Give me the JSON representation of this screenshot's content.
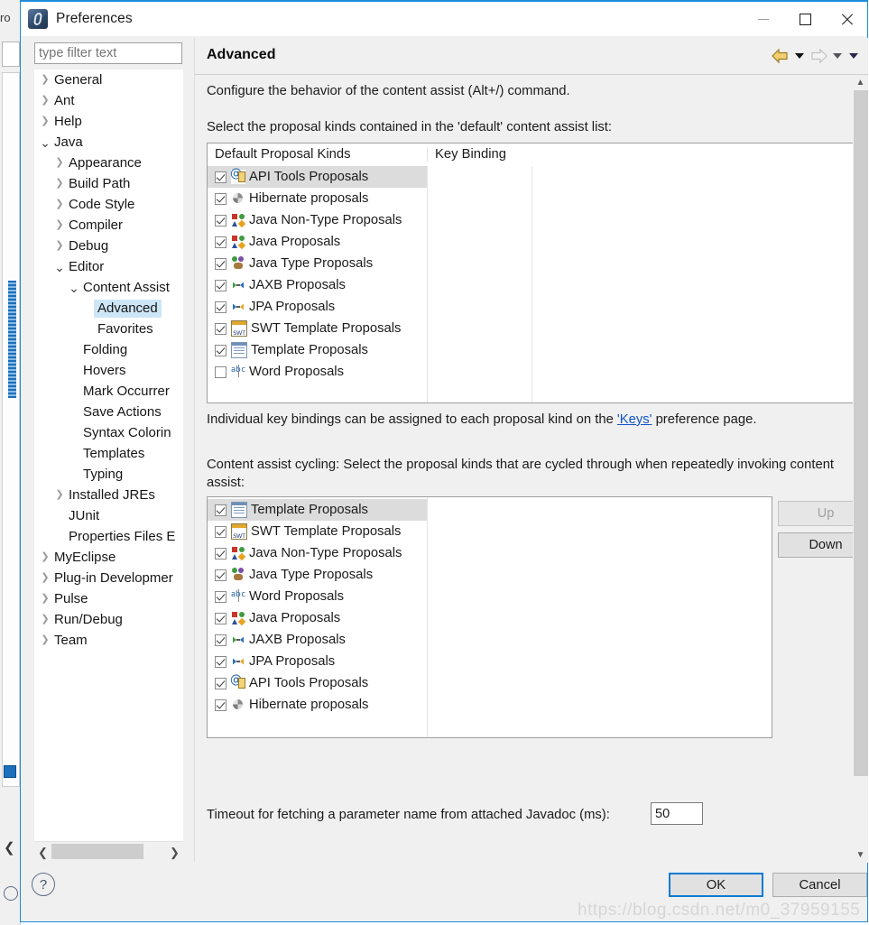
{
  "window": {
    "title": "Preferences",
    "app_icon": "eclipse-icon",
    "controls": {
      "minimize": "minimize-icon",
      "maximize": "maximize-icon",
      "close": "close-icon"
    }
  },
  "filter": {
    "placeholder": "type filter text",
    "value": ""
  },
  "tree": {
    "items": [
      {
        "label": "General",
        "indent": 0,
        "state": "collapsed"
      },
      {
        "label": "Ant",
        "indent": 0,
        "state": "collapsed"
      },
      {
        "label": "Help",
        "indent": 0,
        "state": "collapsed"
      },
      {
        "label": "Java",
        "indent": 0,
        "state": "expanded"
      },
      {
        "label": "Appearance",
        "indent": 1,
        "state": "collapsed"
      },
      {
        "label": "Build Path",
        "indent": 1,
        "state": "collapsed"
      },
      {
        "label": "Code Style",
        "indent": 1,
        "state": "collapsed"
      },
      {
        "label": "Compiler",
        "indent": 1,
        "state": "collapsed"
      },
      {
        "label": "Debug",
        "indent": 1,
        "state": "collapsed"
      },
      {
        "label": "Editor",
        "indent": 1,
        "state": "expanded"
      },
      {
        "label": "Content Assist",
        "indent": 2,
        "state": "expanded"
      },
      {
        "label": "Advanced",
        "indent": 3,
        "state": "leaf",
        "selected": true
      },
      {
        "label": "Favorites",
        "indent": 3,
        "state": "leaf"
      },
      {
        "label": "Folding",
        "indent": 2,
        "state": "leaf"
      },
      {
        "label": "Hovers",
        "indent": 2,
        "state": "leaf"
      },
      {
        "label": "Mark Occurrer",
        "indent": 2,
        "state": "leaf"
      },
      {
        "label": "Save Actions",
        "indent": 2,
        "state": "leaf"
      },
      {
        "label": "Syntax Colorin",
        "indent": 2,
        "state": "leaf"
      },
      {
        "label": "Templates",
        "indent": 2,
        "state": "leaf"
      },
      {
        "label": "Typing",
        "indent": 2,
        "state": "leaf"
      },
      {
        "label": "Installed JREs",
        "indent": 1,
        "state": "collapsed"
      },
      {
        "label": "JUnit",
        "indent": 1,
        "state": "leaf"
      },
      {
        "label": "Properties Files E",
        "indent": 1,
        "state": "leaf"
      },
      {
        "label": "MyEclipse",
        "indent": 0,
        "state": "collapsed"
      },
      {
        "label": "Plug-in Developmer",
        "indent": 0,
        "state": "collapsed"
      },
      {
        "label": "Pulse",
        "indent": 0,
        "state": "collapsed"
      },
      {
        "label": "Run/Debug",
        "indent": 0,
        "state": "collapsed"
      },
      {
        "label": "Team",
        "indent": 0,
        "state": "collapsed"
      }
    ],
    "hscroll": {
      "left_arrow": "chevron-left-icon",
      "right_arrow": "chevron-right-icon"
    }
  },
  "page": {
    "title": "Advanced",
    "nav": {
      "back": "back-arrow-icon",
      "back_menu": "chevron-down-icon",
      "forward": "forward-arrow-icon",
      "forward_menu": "chevron-down-icon",
      "view_menu": "chevron-down-icon"
    },
    "intro": "Configure the behavior of the content assist (Alt+/) command.",
    "default_kinds_prompt": "Select the proposal kinds contained in the 'default' content assist list:",
    "default_table": {
      "columns": [
        "Default Proposal Kinds",
        "Key Binding"
      ],
      "rows": [
        {
          "label": "API Tools Proposals",
          "icon": "api-tools-icon",
          "checked": true,
          "selected": true,
          "key_binding": ""
        },
        {
          "label": "Hibernate proposals",
          "icon": "hibernate-icon",
          "checked": true,
          "selected": false,
          "key_binding": ""
        },
        {
          "label": "Java Non-Type Proposals",
          "icon": "java-nontype-icon",
          "checked": true,
          "selected": false,
          "key_binding": ""
        },
        {
          "label": "Java Proposals",
          "icon": "java-proposals-icon",
          "checked": true,
          "selected": false,
          "key_binding": ""
        },
        {
          "label": "Java Type Proposals",
          "icon": "java-type-icon",
          "checked": true,
          "selected": false,
          "key_binding": ""
        },
        {
          "label": "JAXB Proposals",
          "icon": "jaxb-icon",
          "checked": true,
          "selected": false,
          "key_binding": ""
        },
        {
          "label": "JPA Proposals",
          "icon": "jpa-icon",
          "checked": true,
          "selected": false,
          "key_binding": ""
        },
        {
          "label": "SWT Template Proposals",
          "icon": "swt-template-icon",
          "checked": true,
          "selected": false,
          "key_binding": ""
        },
        {
          "label": "Template Proposals",
          "icon": "template-icon",
          "checked": true,
          "selected": false,
          "key_binding": ""
        },
        {
          "label": "Word Proposals",
          "icon": "word-proposals-icon",
          "checked": false,
          "selected": false,
          "key_binding": ""
        }
      ]
    },
    "keys_note": {
      "before": "Individual key bindings can be assigned to each proposal kind on the ",
      "link": "'Keys'",
      "after": " preference page."
    },
    "cycling_prompt": "Content assist cycling: Select the proposal kinds that are cycled through when repeatedly invoking content assist:",
    "cycling_table": {
      "rows": [
        {
          "label": "Template Proposals",
          "icon": "template-icon",
          "checked": true,
          "selected": true
        },
        {
          "label": "SWT Template Proposals",
          "icon": "swt-template-icon",
          "checked": true,
          "selected": false
        },
        {
          "label": "Java Non-Type Proposals",
          "icon": "java-nontype-icon",
          "checked": true,
          "selected": false
        },
        {
          "label": "Java Type Proposals",
          "icon": "java-type-icon",
          "checked": true,
          "selected": false
        },
        {
          "label": "Word Proposals",
          "icon": "word-proposals-icon",
          "checked": true,
          "selected": false
        },
        {
          "label": "Java Proposals",
          "icon": "java-proposals-icon",
          "checked": true,
          "selected": false
        },
        {
          "label": "JAXB Proposals",
          "icon": "jaxb-icon",
          "checked": true,
          "selected": false
        },
        {
          "label": "JPA Proposals",
          "icon": "jpa-icon",
          "checked": true,
          "selected": false
        },
        {
          "label": "API Tools Proposals",
          "icon": "api-tools-icon",
          "checked": true,
          "selected": false
        },
        {
          "label": "Hibernate proposals",
          "icon": "hibernate-icon",
          "checked": true,
          "selected": false
        }
      ]
    },
    "cycling_buttons": {
      "up": "Up",
      "up_enabled": false,
      "down": "Down",
      "down_enabled": true
    },
    "timeout": {
      "label": "Timeout for fetching a parameter name from attached Javadoc (ms):",
      "value": "50"
    }
  },
  "footer": {
    "help": "?",
    "ok": "OK",
    "cancel": "Cancel"
  },
  "watermark": "https://blog.csdn.net/m0_37959155",
  "colors": {
    "accent": "#0a7bd4",
    "selection": "#cde6f7",
    "row_selection": "#dcdcdc",
    "link": "#1155cc",
    "dialog_bg": "#f0f0f0"
  }
}
